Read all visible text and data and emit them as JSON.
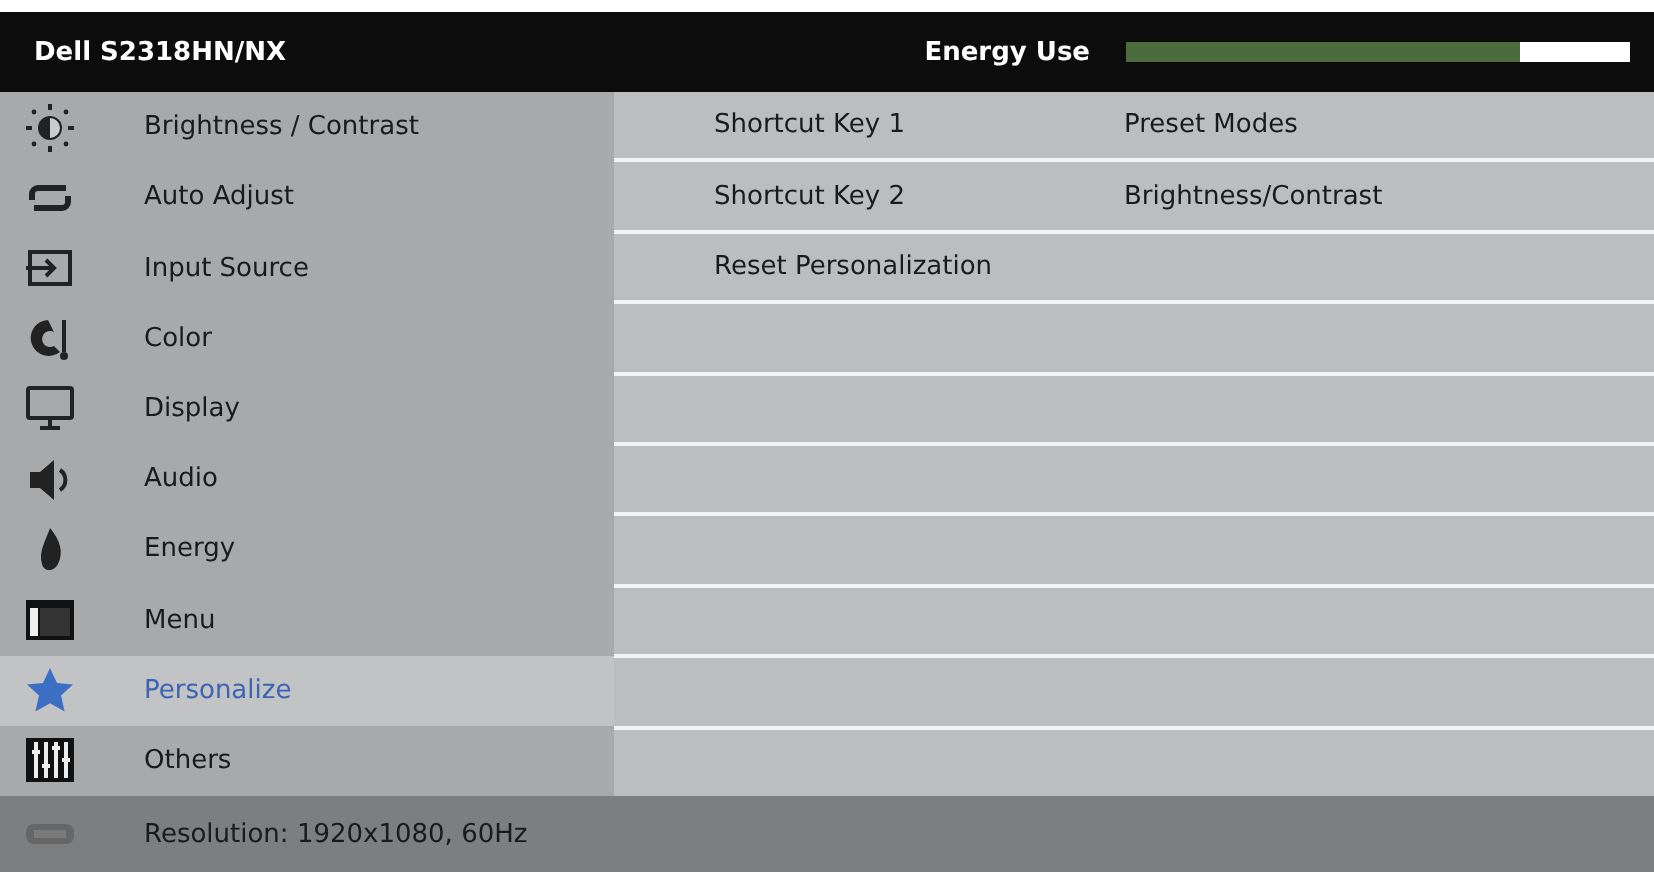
{
  "header": {
    "title": "Dell S2318HN/NX",
    "energy_label": "Energy Use",
    "energy_meter": {
      "level": 0.78
    }
  },
  "menu": [
    {
      "label": "Brightness / Contrast",
      "selected": false
    },
    {
      "label": "Auto Adjust",
      "selected": false
    },
    {
      "label": "Input Source",
      "selected": false
    },
    {
      "label": "Color",
      "selected": false
    },
    {
      "label": "Display",
      "selected": false
    },
    {
      "label": "Audio",
      "selected": false
    },
    {
      "label": "Energy",
      "selected": false
    },
    {
      "label": "Menu",
      "selected": false
    },
    {
      "label": "Personalize",
      "selected": true
    },
    {
      "label": "Others",
      "selected": false
    }
  ],
  "settings": [
    {
      "name": "Shortcut Key 1",
      "value": "Preset Modes"
    },
    {
      "name": "Shortcut Key 2",
      "value": "Brightness/Contrast"
    },
    {
      "name": "Reset Personalization"
    }
  ],
  "status_bar": {
    "text": "Resolution: 1920x1080, 60Hz"
  }
}
